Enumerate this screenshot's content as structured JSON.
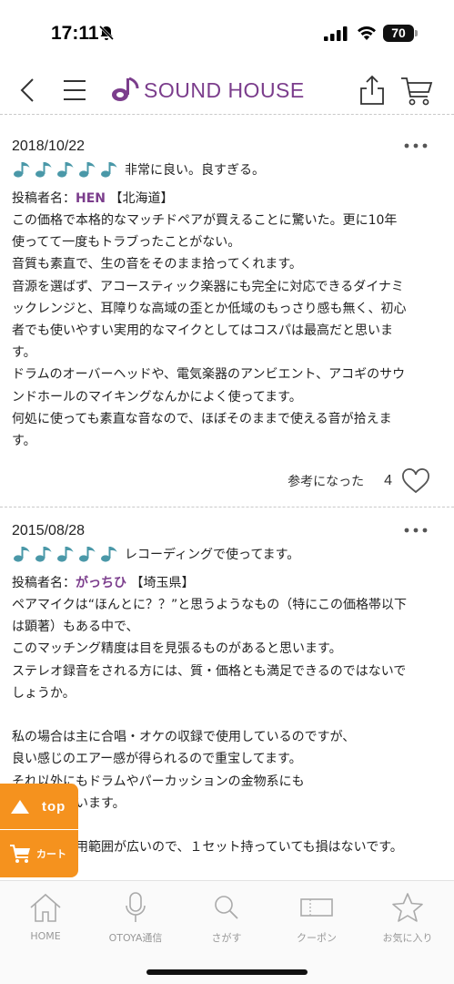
{
  "status_bar": {
    "time": "17:11",
    "battery": "70"
  },
  "header": {
    "logo_text": "SOUND HOUSE"
  },
  "colors": {
    "brand_purple": "#7b3d8c",
    "note_teal": "#4a98a8",
    "float_orange": "#f5921e"
  },
  "reviews": [
    {
      "date": "2018/10/22",
      "rating": 5,
      "title": "非常に良い。良すぎる。",
      "poster_prefix": "投稿者名：",
      "poster_name": "HEN",
      "poster_region": " 【北海道】",
      "body": "この価格で本格的なマッチドペアが買えることに驚いた。更に10年\n使ってて一度もトラブったことがない。\n音質も素直で、生の音をそのまま拾ってくれます。\n音源を選ばず、アコースティック楽器にも完全に対応できるダイナミ\nックレンジと、耳障りな高域の歪とか低域のもっさり感も無く、初心\n者でも使いやすい実用的なマイクとしてはコスパは最高だと思いま\nす。\nドラムのオーバーヘッドや、電気楽器のアンビエント、アコギのサウ\nンドホールのマイキングなんかによく使ってます。\n何処に使っても素直な音なので、ほぼそのままで使える音が拾えま\nす。",
      "helpful_label": "参考になった",
      "helpful_count": "4"
    },
    {
      "date": "2015/08/28",
      "rating": 5,
      "title": "レコーディングで使ってます。",
      "poster_prefix": "投稿者名：",
      "poster_name": "がっちひ",
      "poster_region": " 【埼玉県】",
      "body": "ペアマイクは“ほんとに？？”と思うようなもの（特にこの価格帯以下\nは顕著）もある中で、\nこのマッチング精度は目を見張るものがあると思います。\nステレオ録音をされる方には、質・価格とも満足できるのではないで\nしょうか。\n\n私の場合は主に合唱・オケの収録で使用しているのですが、\n良い感じのエアー感が得られるので重宝してます。\nそれ以外にもドラムやパーカッションの金物系にも\n　　　　思います。\n\n　　　　使用範囲が広いので、１セット持っていても損はないです。"
    }
  ],
  "floating": {
    "top_label": "top",
    "cart_label": "カート"
  },
  "bottom_nav": [
    {
      "label": "HOME",
      "icon": "home-icon"
    },
    {
      "label": "OTOYA通信",
      "icon": "microphone-icon"
    },
    {
      "label": "さがす",
      "icon": "search-icon"
    },
    {
      "label": "クーポン",
      "icon": "coupon-icon"
    },
    {
      "label": "お気に入り",
      "icon": "star-icon"
    }
  ]
}
